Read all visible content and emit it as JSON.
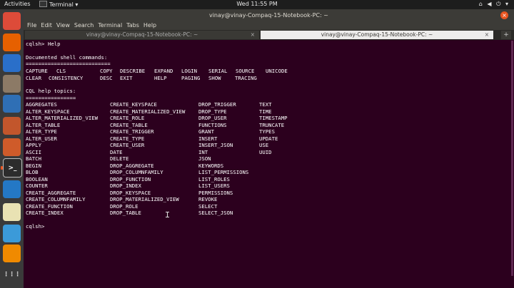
{
  "topbar": {
    "activities": "Activities",
    "app": "Terminal",
    "app_arrow": "▾",
    "clock": "Wed 11:55 PM",
    "status_icons": "⌂ ◀ ⏻ ▾"
  },
  "window": {
    "title": "vinay@vinay-Compaq-15-Notebook-PC: ~",
    "close_glyph": "×",
    "menu": [
      "File",
      "Edit",
      "View",
      "Search",
      "Terminal",
      "Tabs",
      "Help"
    ],
    "tabs": [
      {
        "label": "vinay@vinay-Compaq-15-Notebook-PC: ~",
        "close": "×"
      },
      {
        "label": "vinay@vinay-Compaq-15-Notebook-PC: ~",
        "close": "×"
      }
    ],
    "new_tab": "+"
  },
  "dock": [
    {
      "name": "chrome-icon",
      "glyph": "",
      "color": "#dd4b39"
    },
    {
      "name": "firefox-icon",
      "glyph": "",
      "color": "#e66000"
    },
    {
      "name": "thunderbird-icon",
      "glyph": "",
      "color": "#2a6fc9"
    },
    {
      "name": "files-icon",
      "glyph": "",
      "color": "#8c7a66"
    },
    {
      "name": "writer-icon",
      "glyph": "",
      "color": "#2f6fb5"
    },
    {
      "name": "impress-icon",
      "glyph": "",
      "color": "#c2562c"
    },
    {
      "name": "software-icon",
      "glyph": "",
      "color": "#cf5b2a"
    },
    {
      "name": "terminal-icon",
      "glyph": ">_",
      "color": "#2c2c2c"
    },
    {
      "name": "vscode-icon",
      "glyph": "",
      "color": "#2478c5"
    },
    {
      "name": "editor-icon",
      "glyph": "",
      "color": "#e9e2b3"
    },
    {
      "name": "settings-icon",
      "glyph": "",
      "color": "#3b9ad9"
    },
    {
      "name": "vlc-icon",
      "glyph": "",
      "color": "#f08a00"
    },
    {
      "name": "apps-grid-icon",
      "glyph": "⋮⋮⋮",
      "color": "#3a3a3a"
    }
  ],
  "terminal": {
    "prompt": "cqlsh> ",
    "command": "Help",
    "doc_heading": "Documented shell commands:",
    "doc_rule": "===========================",
    "shell_commands": [
      [
        "CAPTURE",
        "CLS",
        "COPY",
        "DESCRIBE",
        "EXPAND",
        "LOGIN",
        "SERIAL",
        "SOURCE",
        "UNICODE"
      ],
      [
        "CLEAR",
        "CONSISTENCY",
        "DESC",
        "EXIT",
        "HELP",
        "PAGING",
        "SHOW",
        "TRACING"
      ]
    ],
    "topics_heading": "CQL help topics:",
    "topics_rule": "================",
    "topics_columns": [
      [
        "AGGREGATES",
        "ALTER_KEYSPACE",
        "ALTER_MATERIALIZED_VIEW",
        "ALTER_TABLE",
        "ALTER_TYPE",
        "ALTER_USER",
        "APPLY",
        "ASCII",
        "BATCH",
        "BEGIN",
        "BLOB",
        "BOOLEAN",
        "COUNTER",
        "CREATE_AGGREGATE",
        "CREATE_COLUMNFAMILY",
        "CREATE_FUNCTION",
        "CREATE_INDEX"
      ],
      [
        "CREATE_KEYSPACE",
        "CREATE_MATERIALIZED_VIEW",
        "CREATE_ROLE",
        "CREATE_TABLE",
        "CREATE_TRIGGER",
        "CREATE_TYPE",
        "CREATE_USER",
        "DATE",
        "DELETE",
        "DROP_AGGREGATE",
        "DROP_COLUMNFAMILY",
        "DROP_FUNCTION",
        "DROP_INDEX",
        "DROP_KEYSPACE",
        "DROP_MATERIALIZED_VIEW",
        "DROP_ROLE",
        "DROP_TABLE"
      ],
      [
        "DROP_TRIGGER",
        "DROP_TYPE",
        "DROP_USER",
        "FUNCTIONS",
        "GRANT",
        "INSERT",
        "INSERT_JSON",
        "INT",
        "JSON",
        "KEYWORDS",
        "LIST_PERMISSIONS",
        "LIST_ROLES",
        "LIST_USERS",
        "PERMISSIONS",
        "REVOKE",
        "SELECT",
        "SELECT_JSON"
      ],
      [
        "TEXT",
        "TIME",
        "TIMESTAMP",
        "TRUNCATE",
        "TYPES",
        "UPDATE",
        "USE",
        "UUID"
      ]
    ],
    "final_prompt": "cqlsh>"
  },
  "colors": {
    "terminal_bg": "#2c001e",
    "accent": "#e95420",
    "text": "#ffffff"
  }
}
